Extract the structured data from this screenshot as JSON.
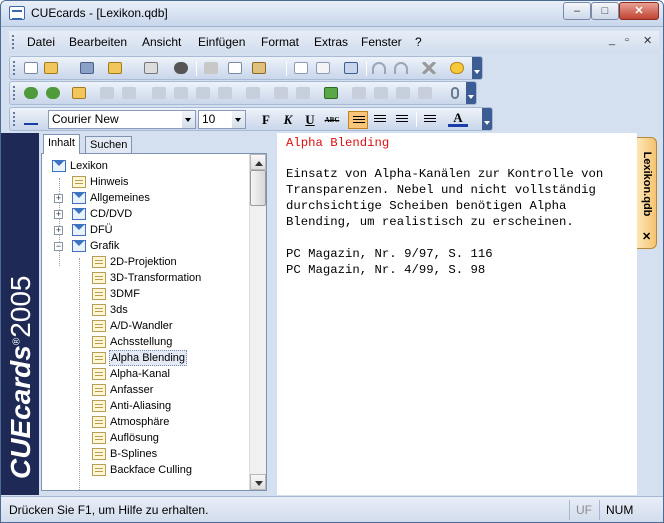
{
  "window": {
    "title": "CUEcards - [Lexikon.qdb]",
    "minimize": "–",
    "maximize": "□",
    "close": "✕"
  },
  "menu": {
    "items": [
      "Datei",
      "Bearbeiten",
      "Ansicht",
      "Einfügen",
      "Format",
      "Extras",
      "Fenster",
      "?"
    ],
    "mdi_minimize": "_",
    "mdi_restore": "▫",
    "mdi_close": "✕"
  },
  "format_bar": {
    "font_name": "Courier New",
    "font_size": "10",
    "bold": "F",
    "italic": "K",
    "underline": "U",
    "strike": "ABC"
  },
  "sidebar": {
    "brand": "CUEcards",
    "reg": "®",
    "year": "2005"
  },
  "nav_tabs": {
    "contents": "Inhalt",
    "search": "Suchen"
  },
  "tree": {
    "root": "Lexikon",
    "level1": [
      "Hinweis",
      "Allgemeines",
      "CD/DVD",
      "DFÜ",
      "Grafik"
    ],
    "grafik_children": [
      "2D-Projektion",
      "3D-Transformation",
      "3DMF",
      "3ds",
      "A/D-Wandler",
      "Achsstellung",
      "Alpha Blending",
      "Alpha-Kanal",
      "Anfasser",
      "Anti-Aliasing",
      "Atmosphäre",
      "Auflösung",
      "B-Splines",
      "Backface Culling"
    ],
    "selected": "Alpha Blending",
    "scroll_thumb_fraction": 0.12
  },
  "editor": {
    "title": "Alpha Blending",
    "lines": [
      "Einsatz von Alpha-Kanälen zur Kontrolle von",
      "Transparenzen. Nebel und nicht vollständig",
      "durchsichtige Scheiben benötigen Alpha",
      "Blending, um realistisch zu erscheinen.",
      "",
      "PC Magazin, Nr. 9/97, S. 116",
      "PC Magazin, Nr. 4/99, S. 98"
    ]
  },
  "doc_tab": {
    "label": "Lexikon.qdb",
    "close": "✕"
  },
  "status": {
    "message": "Drücken Sie F1, um Hilfe zu erhalten.",
    "uf": "UF",
    "num": "NUM"
  },
  "colors": {
    "sidebar_bg": "#1e2a55",
    "editor_title": "#e01010",
    "active_button": "#f9c57a"
  }
}
